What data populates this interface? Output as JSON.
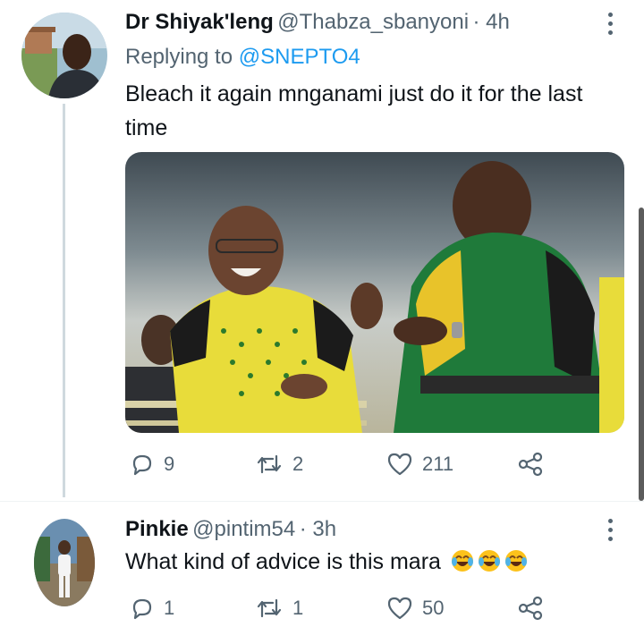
{
  "tweet1": {
    "display_name": "Dr Shiyak'leng",
    "handle": "@Thabza_sbanyoni",
    "time": "· 4h",
    "replying_prefix": "Replying to",
    "replying_to": "@SNEPTO4",
    "text": "Bleach it again mnganami just do it for the last time",
    "replies": "9",
    "retweets": "2",
    "likes": "211"
  },
  "tweet2": {
    "display_name": "Pinkie",
    "handle": "@pintim54",
    "time": "· 3h",
    "text": "What kind of advice is this mara",
    "emojis": [
      "face-with-tears-of-joy",
      "face-with-tears-of-joy",
      "face-with-tears-of-joy"
    ],
    "replies": "1",
    "retweets": "1",
    "likes": "50"
  },
  "colors": {
    "link": "#1d9bf0",
    "secondary_text": "#536471",
    "primary_text": "#0f1419"
  }
}
